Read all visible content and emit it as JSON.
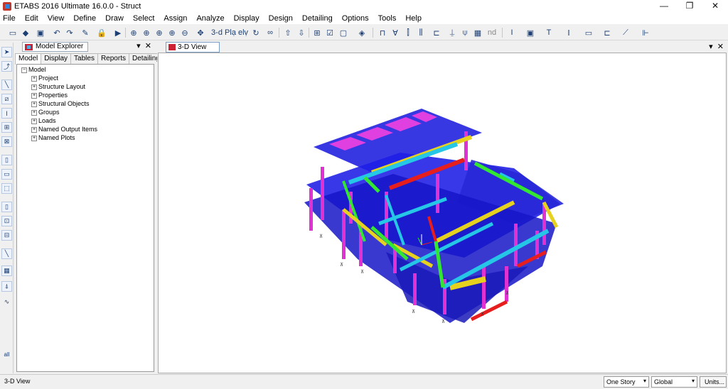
{
  "window": {
    "title": "ETABS 2016 Ultimate 16.0.0 - Struct"
  },
  "menu": [
    "File",
    "Edit",
    "View",
    "Define",
    "Draw",
    "Select",
    "Assign",
    "Analyze",
    "Display",
    "Design",
    "Detailing",
    "Options",
    "Tools",
    "Help"
  ],
  "toolbar": {
    "label_3d": "3-d",
    "label_nd": "nd",
    "label_pl": "Plạ",
    "label_elv": "elṿ"
  },
  "explorer": {
    "title": "Model Explorer",
    "tabs": [
      "Model",
      "Display",
      "Tables",
      "Reports",
      "Detailing"
    ],
    "tree_root": "Model",
    "tree_items": [
      "Project",
      "Structure Layout",
      "Properties",
      "Structural Objects",
      "Groups",
      "Loads",
      "Named Output Items",
      "Named Plots"
    ]
  },
  "view": {
    "tab_label": "3-D View"
  },
  "status": {
    "left_text": "3-D View",
    "story_select": "One Story",
    "coord_select": "Global",
    "units_button": "Units..."
  },
  "left_tools_label": "all",
  "colors": {
    "slab_blue": "#1e1ee6",
    "beam_cyan": "#26c6e6",
    "beam_yellow": "#e6d21e",
    "beam_green": "#32e632",
    "beam_red": "#e61e1e",
    "column_magenta": "#e632d2"
  }
}
